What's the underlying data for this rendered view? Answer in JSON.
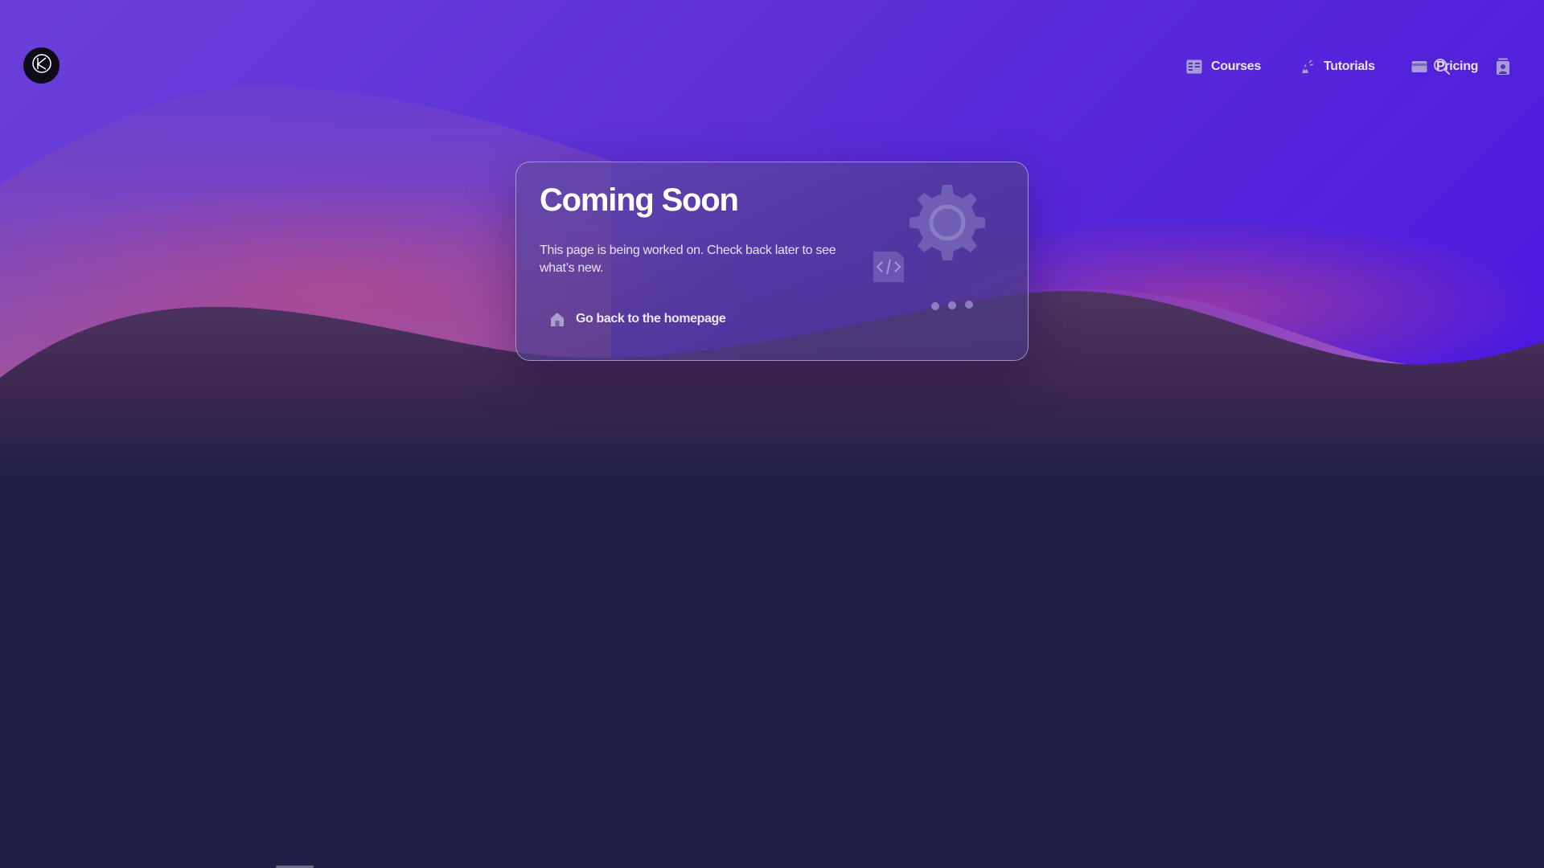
{
  "header": {
    "logo_icon": "logo-icon",
    "nav": [
      {
        "label": "Courses",
        "icon": "courses-icon"
      },
      {
        "label": "Tutorials",
        "icon": "tutorials-icon"
      },
      {
        "label": "Pricing",
        "icon": "pricing-icon"
      }
    ],
    "search_icon": "search-icon",
    "account_icon": "account-icon"
  },
  "card": {
    "title": "Coming Soon",
    "text": "This page is being worked on. Check back later to see what’s new.",
    "link_label": "Go back to the homepage",
    "link_icon": "home-icon",
    "illustration_icons": [
      "gear-icon",
      "code-icon",
      "dots-icon"
    ]
  },
  "colors": {
    "bg_top": "#5b2fd6",
    "bg_bottom": "#201f48",
    "card_border": "#ffffff",
    "text": "#ffffff"
  }
}
